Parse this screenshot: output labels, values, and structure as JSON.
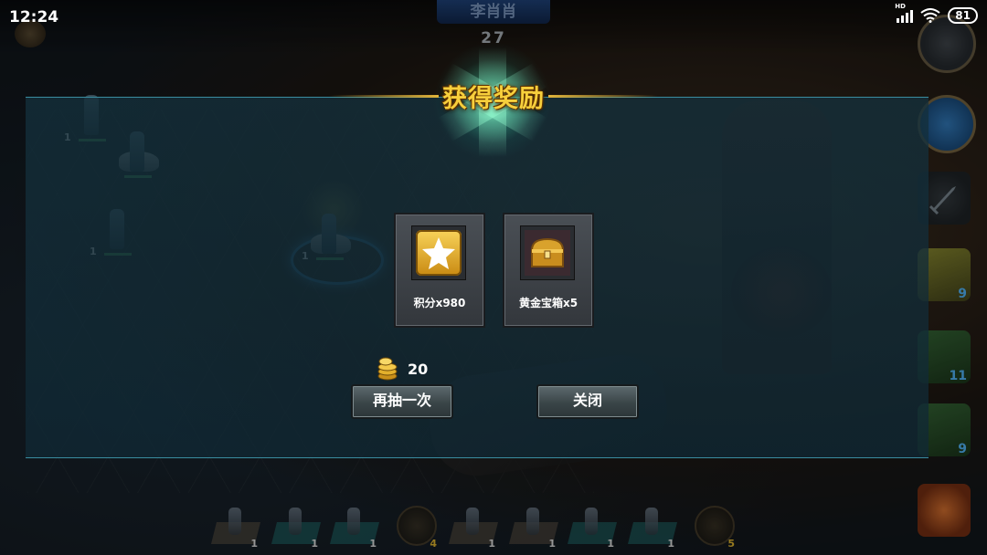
{
  "status_bar": {
    "time": "12:24",
    "battery": "81"
  },
  "match": {
    "player_name": "李肖肖",
    "timer": "27"
  },
  "dialog": {
    "title": "获得奖励",
    "rewards": [
      {
        "icon": "star-icon",
        "label": "积分x980"
      },
      {
        "icon": "treasure-chest-icon",
        "label": "黄金宝箱x5"
      }
    ],
    "cost": {
      "icon": "gold-coins-icon",
      "amount": "20"
    },
    "buttons": {
      "draw_again": "再抽一次",
      "close": "关闭"
    }
  },
  "side_skills": [
    {
      "icon": "horse-charge-icon",
      "count": "9"
    },
    {
      "icon": "boot-icon",
      "count": "11"
    },
    {
      "icon": "boot-icon",
      "count": "9"
    }
  ],
  "battlefield_units": [
    "1",
    "1",
    "1",
    "1"
  ],
  "deck": [
    {
      "icon": "spearman-card-icon",
      "count": "1"
    },
    {
      "icon": "spearman-card-icon",
      "count": "1"
    },
    {
      "icon": "cavalry-card-icon",
      "count": "1"
    },
    {
      "icon": "hourglass-icon",
      "count": "4"
    },
    {
      "icon": "cavalry-card-icon",
      "count": "1"
    },
    {
      "icon": "spearman-card-icon",
      "count": "1"
    },
    {
      "icon": "spearman-card-icon",
      "count": "1"
    },
    {
      "icon": "cavalry-card-icon",
      "count": "1"
    },
    {
      "icon": "hourglass-icon",
      "count": "5"
    }
  ],
  "colors": {
    "title_gold": "#f7cf3c",
    "dialog_border": "#3a8da0",
    "count_blue": "#4aa3e0"
  }
}
